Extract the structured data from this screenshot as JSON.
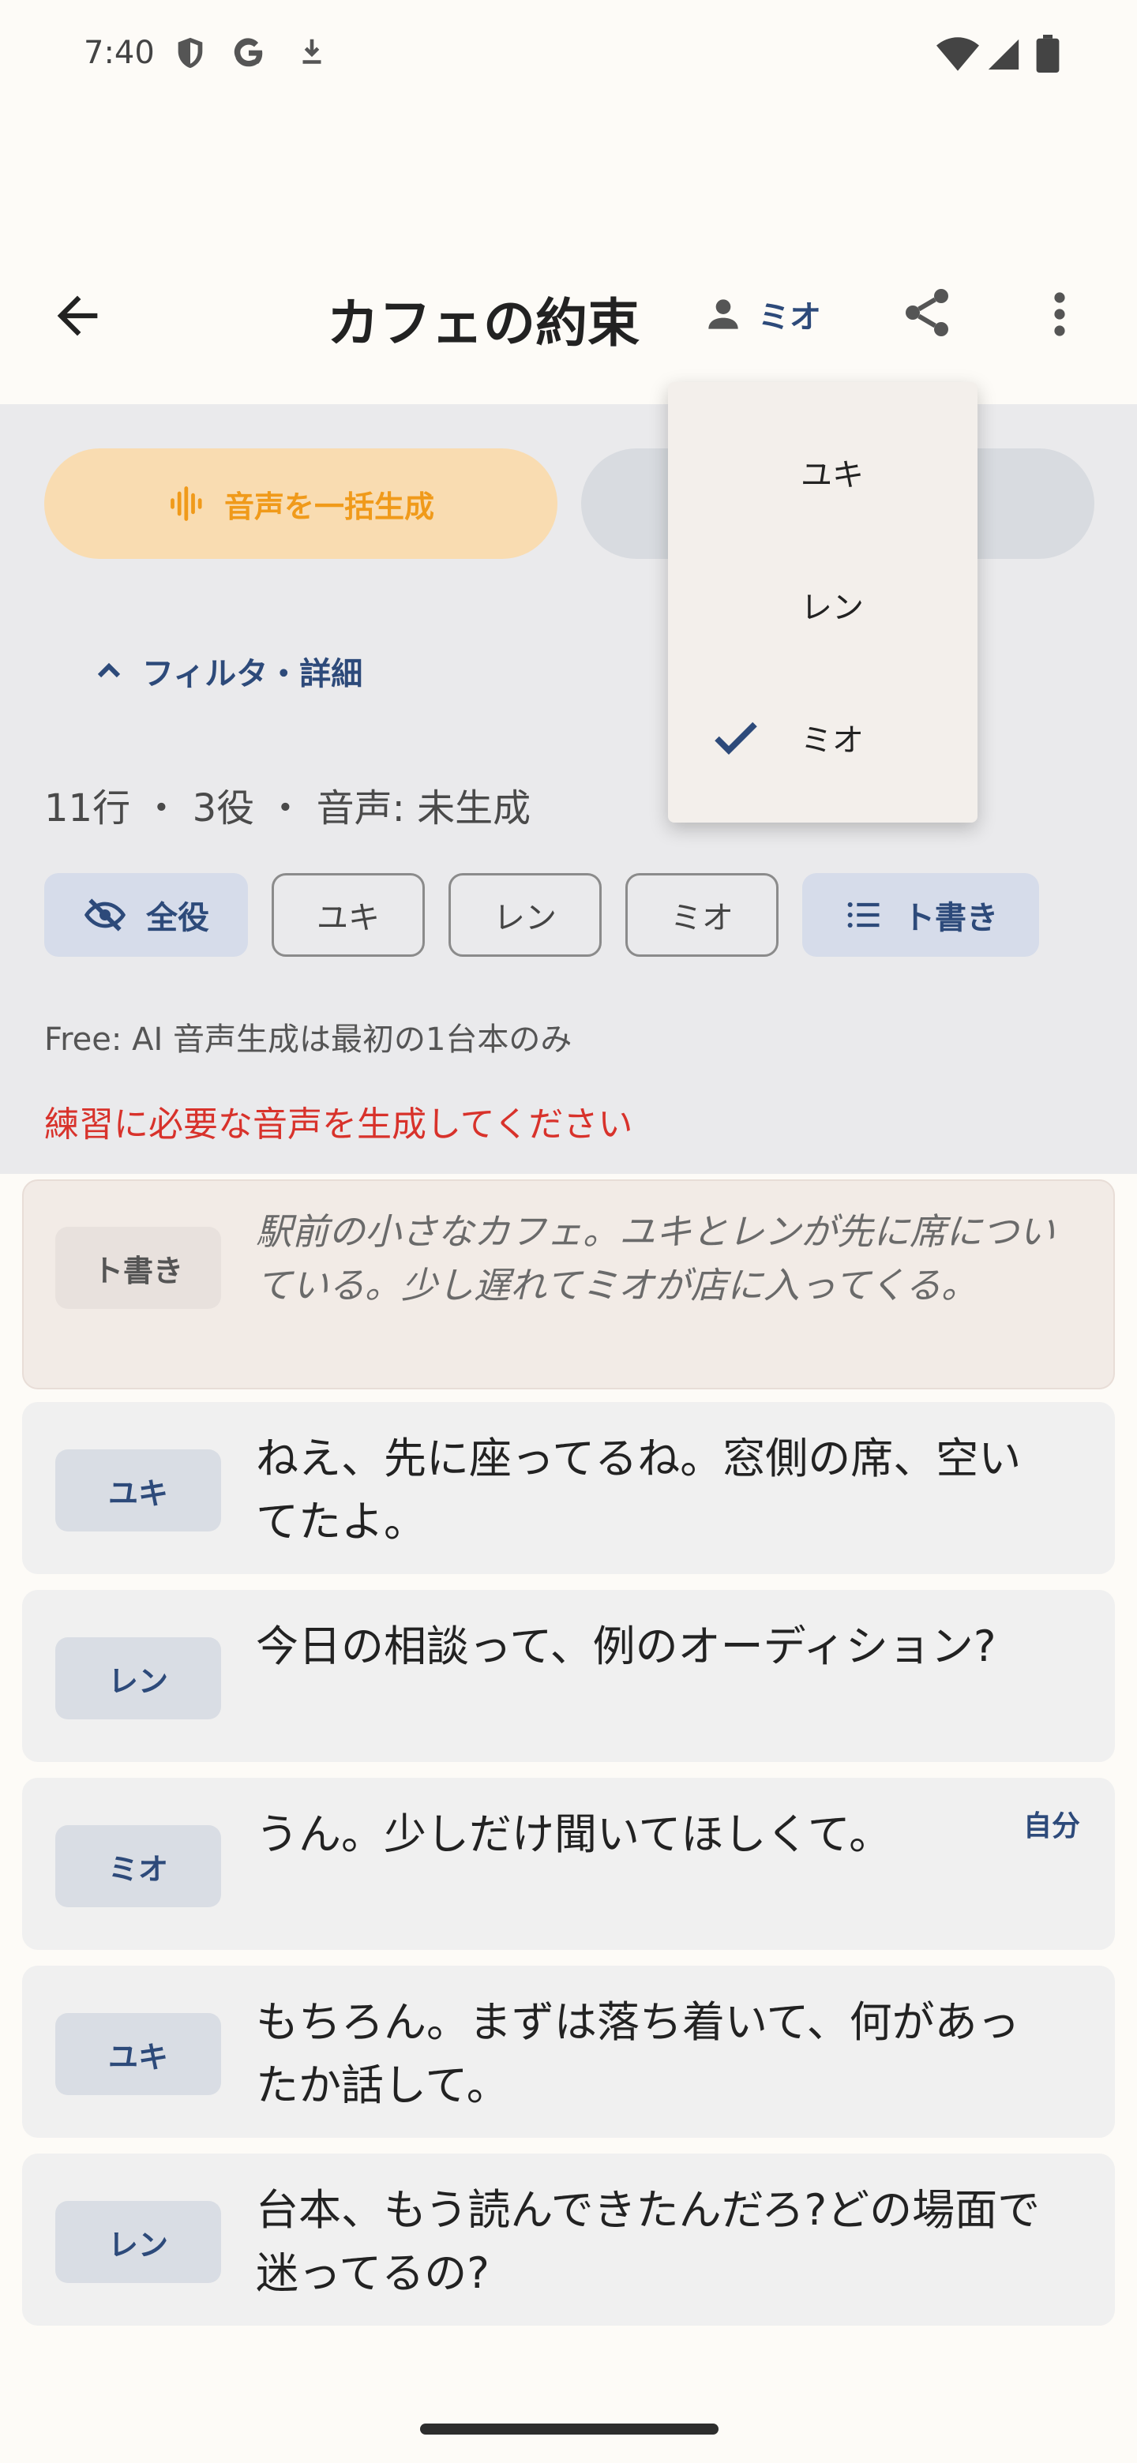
{
  "status_bar": {
    "time": "7:40",
    "icons": [
      "shield-icon",
      "google-icon",
      "download-icon",
      "wifi-icon",
      "signal-icon",
      "battery-icon"
    ]
  },
  "app_bar": {
    "title": "カフェの約束",
    "role_selector_label": "ミオ",
    "icons": [
      "back-arrow-icon",
      "person-icon",
      "share-icon",
      "more-vert-icon"
    ]
  },
  "actions": {
    "generate_all_label": "音声を一括生成"
  },
  "filter": {
    "toggle_label": "フィルタ・詳細",
    "stats": "11行 ・ 3役 ・ 音声: 未生成",
    "chips": [
      {
        "label": "全役",
        "selected": true,
        "icon": "visibility-off-icon"
      },
      {
        "label": "ユキ",
        "selected": false
      },
      {
        "label": "レン",
        "selected": false
      },
      {
        "label": "ミオ",
        "selected": false
      },
      {
        "label": "ト書き",
        "selected": true,
        "icon": "list-icon"
      }
    ],
    "free_note": "Free: AI 音声生成は最初の1台本のみ",
    "warning": "練習に必要な音声を生成してください"
  },
  "script_lines": [
    {
      "speaker": "ト書き",
      "text": "駅前の小さなカフェ。ユキとレンが先に席についている。少し遅れてミオが店に入ってくる。",
      "kind": "stage"
    },
    {
      "speaker": "ユキ",
      "text": "ねえ、先に座ってるね。窓側の席、空いてたよ。",
      "kind": "role"
    },
    {
      "speaker": "レン",
      "text": "今日の相談って、例のオーディション?",
      "kind": "role"
    },
    {
      "speaker": "ミオ",
      "text": "うん。少しだけ聞いてほしくて。",
      "kind": "role",
      "tag": "自分"
    },
    {
      "speaker": "ユキ",
      "text": "もちろん。まずは落ち着いて、何があったか話して。",
      "kind": "role"
    },
    {
      "speaker": "レン",
      "text": "台本、もう読んできたんだろ?どの場面で迷ってるの?",
      "kind": "role"
    }
  ],
  "role_menu": {
    "items": [
      {
        "label": "ユキ",
        "checked": false
      },
      {
        "label": "レン",
        "checked": false
      },
      {
        "label": "ミオ",
        "checked": true
      }
    ]
  },
  "colors": {
    "accent": "#2d4a7a",
    "generate_bg": "#f9dcb1",
    "generate_fg": "#f09a1a",
    "warning": "#d8322b"
  }
}
